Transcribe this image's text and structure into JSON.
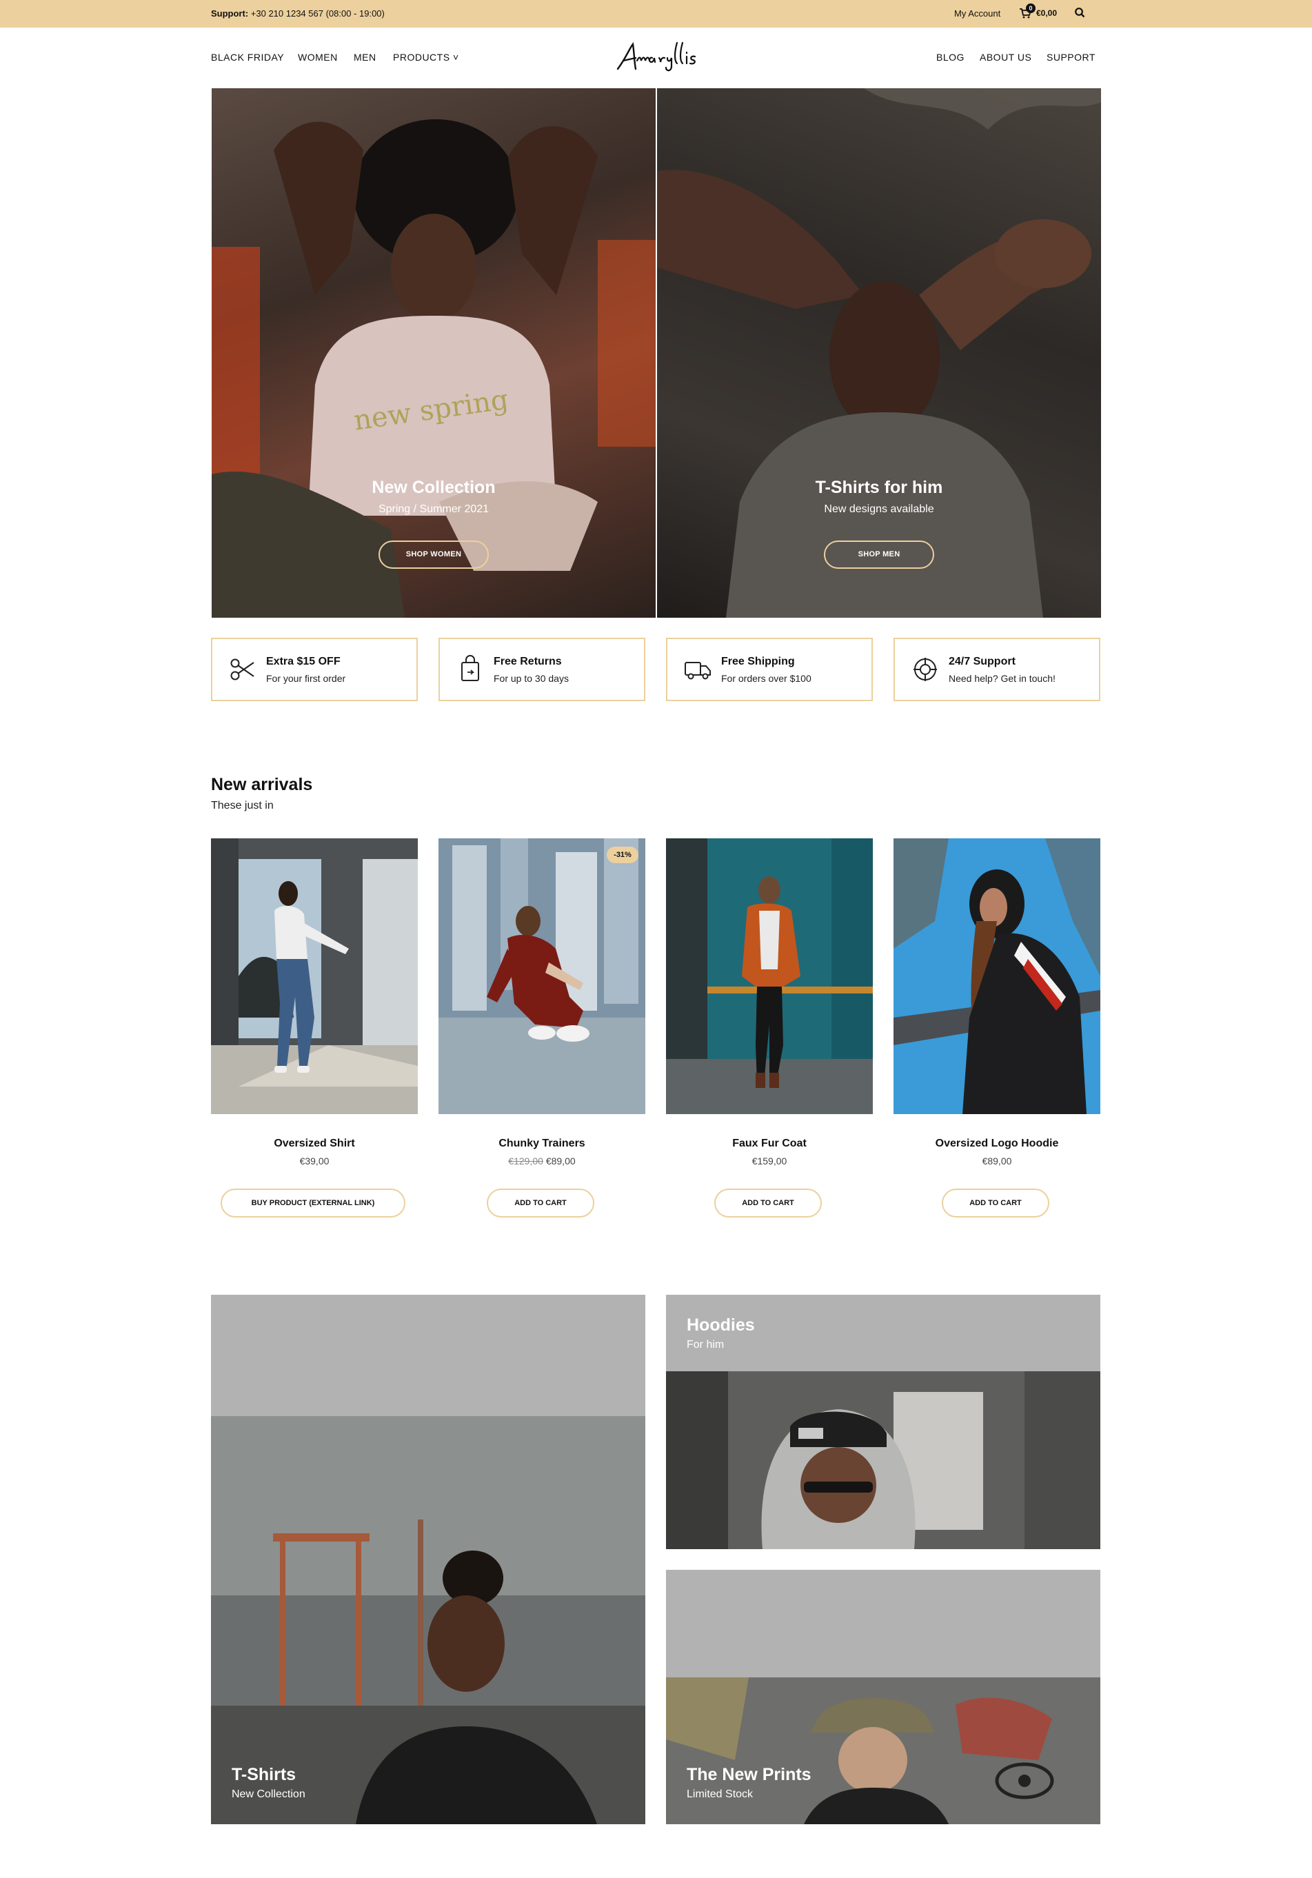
{
  "topbar": {
    "support_label": "Support:",
    "support_text": "+30 210 1234 567 (08:00 - 19:00)",
    "account_label": "My Account",
    "cart_count": "0",
    "cart_total": "€0,00"
  },
  "nav": {
    "left": [
      "BLACK FRIDAY",
      "WOMEN",
      "MEN",
      "PRODUCTS ˅"
    ],
    "right": [
      "BLOG",
      "ABOUT US",
      "SUPPORT"
    ],
    "logo": "Amaryllis"
  },
  "hero": [
    {
      "title": "New Collection",
      "subtitle": "Spring / Summer 2021",
      "button": "SHOP WOMEN"
    },
    {
      "title": "T-Shirts for him",
      "subtitle": "New designs available",
      "button": "SHOP MEN"
    }
  ],
  "features": [
    {
      "title": "Extra $15 OFF",
      "subtitle": "For your first order",
      "icon": "scissors-icon"
    },
    {
      "title": "Free Returns",
      "subtitle": "For up to 30 days",
      "icon": "shopping-bag-icon"
    },
    {
      "title": "Free Shipping",
      "subtitle": "For orders over $100",
      "icon": "truck-icon"
    },
    {
      "title": "24/7 Support",
      "subtitle": "Need help? Get in touch!",
      "icon": "lifebuoy-icon"
    }
  ],
  "arrivals": {
    "title": "New arrivals",
    "subtitle": "These just in",
    "products": [
      {
        "name": "Oversized Shirt",
        "price": "€39,00",
        "old_price": "",
        "button": "BUY PRODUCT (EXTERNAL LINK)",
        "badge": ""
      },
      {
        "name": "Chunky Trainers",
        "price": "€89,00",
        "old_price": "€129,00",
        "button": "ADD TO CART",
        "badge": "-31%"
      },
      {
        "name": "Faux Fur Coat",
        "price": "€159,00",
        "old_price": "",
        "button": "ADD TO CART",
        "badge": ""
      },
      {
        "name": "Oversized Logo Hoodie",
        "price": "€89,00",
        "old_price": "",
        "button": "ADD TO CART",
        "badge": ""
      }
    ]
  },
  "categories": [
    {
      "title": "T-Shirts",
      "subtitle": "New Collection"
    },
    {
      "title": "Hoodies",
      "subtitle": "For him"
    },
    {
      "title": "The New Prints",
      "subtitle": "Limited Stock"
    }
  ],
  "colors": {
    "accent": "#ecd09d",
    "placeholder_gray": "#b2b2b2"
  }
}
